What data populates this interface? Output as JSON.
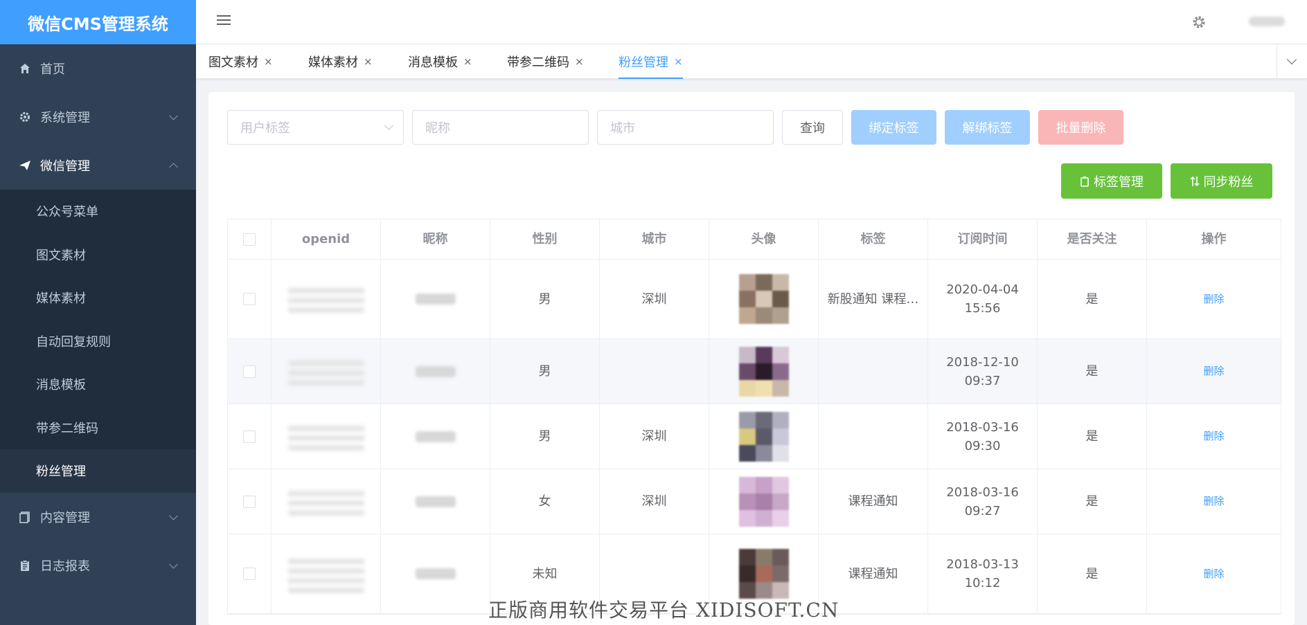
{
  "app": {
    "title": "微信CMS管理系统"
  },
  "sidebar": {
    "items": [
      {
        "label": "首页",
        "icon": "home-icon"
      },
      {
        "label": "系统管理",
        "icon": "gear-icon"
      },
      {
        "label": "微信管理",
        "icon": "paper-plane-icon"
      },
      {
        "label": "内容管理",
        "icon": "document-icon"
      },
      {
        "label": "日志报表",
        "icon": "clipboard-icon"
      }
    ],
    "submenu": [
      "公众号菜单",
      "图文素材",
      "媒体素材",
      "自动回复规则",
      "消息模板",
      "带参二维码",
      "粉丝管理"
    ]
  },
  "tabs": [
    {
      "label": "图文素材",
      "close": "×"
    },
    {
      "label": "媒体素材",
      "close": "×"
    },
    {
      "label": "消息模板",
      "close": "×"
    },
    {
      "label": "带参二维码",
      "close": "×"
    },
    {
      "label": "粉丝管理",
      "close": "×"
    }
  ],
  "filters": {
    "tag_placeholder": "用户标签",
    "nickname_placeholder": "昵称",
    "city_placeholder": "城市",
    "query": "查询",
    "bind_tag": "绑定标签",
    "unbind_tag": "解绑标签",
    "batch_delete": "批量删除",
    "tag_manage": "标签管理",
    "sync_fans": "同步粉丝"
  },
  "table": {
    "headers": [
      "openid",
      "昵称",
      "性别",
      "城市",
      "头像",
      "标签",
      "订阅时间",
      "是否关注",
      "操作"
    ],
    "rows": [
      {
        "gender": "男",
        "city": "深圳",
        "tags": "新股通知 课程…",
        "time": "2020-04-04 15:56",
        "followed": "是",
        "action": "删除"
      },
      {
        "gender": "男",
        "city": "",
        "tags": "",
        "time": "2018-12-10 09:37",
        "followed": "是",
        "action": "删除"
      },
      {
        "gender": "男",
        "city": "深圳",
        "tags": "",
        "time": "2018-03-16 09:30",
        "followed": "是",
        "action": "删除"
      },
      {
        "gender": "女",
        "city": "深圳",
        "tags": "课程通知",
        "time": "2018-03-16 09:27",
        "followed": "是",
        "action": "删除"
      },
      {
        "gender": "未知",
        "city": "",
        "tags": "课程通知",
        "time": "2018-03-13 10:12",
        "followed": "是",
        "action": "删除"
      }
    ]
  },
  "watermark": "正版商用软件交易平台 XIDISOFT.CN",
  "colors": {
    "accent": "#409eff",
    "sidebar": "#304156",
    "green": "#67c23a"
  }
}
